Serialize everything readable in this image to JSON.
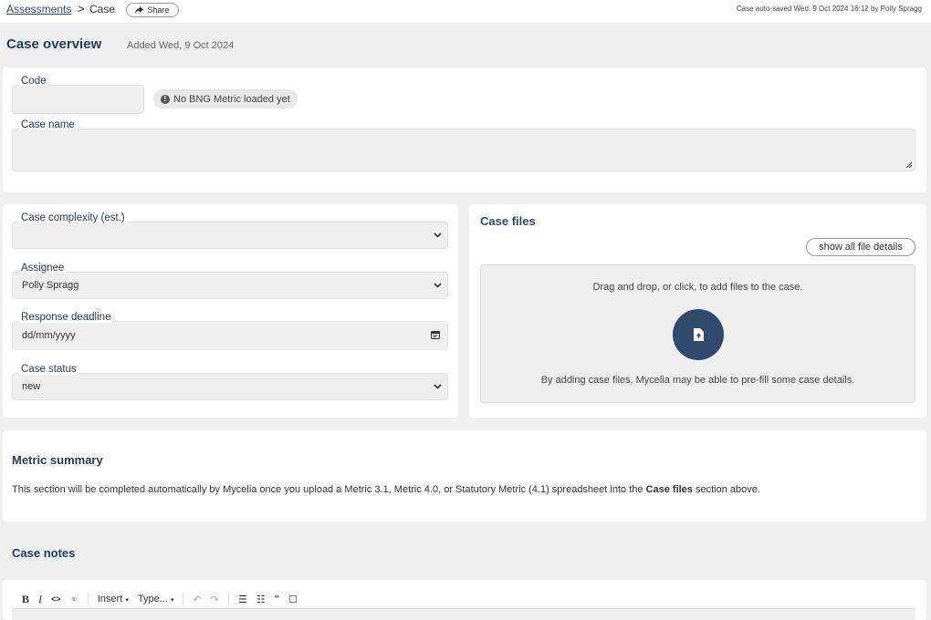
{
  "breadcrumb": {
    "parent": "Assessments",
    "separator": ">",
    "current": "Case"
  },
  "share_label": "Share",
  "autosave_text": "Case auto-saved Wed, 9 Oct 2024 16:12 by Polly Spragg",
  "page": {
    "title": "Case overview",
    "added": "Added Wed, 9 Oct 2024"
  },
  "code": {
    "label": "Code",
    "value": ""
  },
  "metric_badge": "No BNG Metric loaded yet",
  "case_name": {
    "label": "Case name",
    "value": ""
  },
  "complexity": {
    "label": "Case complexity (est.)",
    "value": ""
  },
  "assignee": {
    "label": "Assignee",
    "value": "Polly Spragg"
  },
  "deadline": {
    "label": "Response deadline",
    "placeholder": "dd/mm/yyyy"
  },
  "status": {
    "label": "Case status",
    "value": "new"
  },
  "case_files": {
    "title": "Case files",
    "show_details": "show all file details",
    "drop_text": "Drag and drop, or click, to add files to the case.",
    "prefill_text": "By adding case files, Mycelia may be able to pre-fill some case details."
  },
  "metric_summary": {
    "title": "Metric summary",
    "desc_before": "This section will be completed automatically by Mycelia once you upload a Metric 3.1, Metric 4.0, or Statutory Metric (4.1) spreadsheet into the ",
    "desc_bold": "Case files",
    "desc_after": " section above."
  },
  "case_notes": {
    "title": "Case notes",
    "toolbar": {
      "bold": "B",
      "italic": "I",
      "code": "<>",
      "insert": "Insert",
      "type": "Type..."
    }
  },
  "colors": {
    "accent": "#2f4a6b",
    "link": "#2b4a6f",
    "background": "#efefef"
  }
}
